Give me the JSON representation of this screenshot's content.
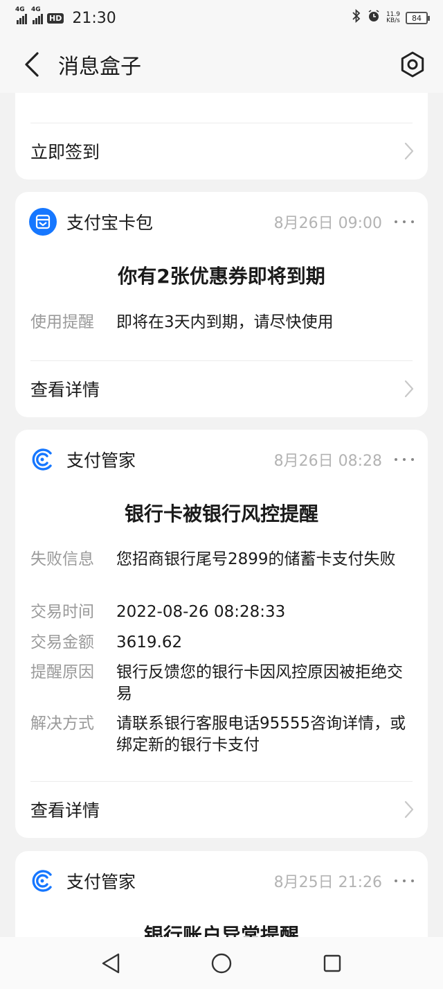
{
  "status_bar": {
    "net1": "4G",
    "net2": "4G",
    "hd": "HD",
    "time": "21:30",
    "speed_value": "11.9",
    "speed_unit": "KB/s",
    "battery": "84"
  },
  "header": {
    "title": "消息盒子"
  },
  "cards": [
    {
      "link_label": "立即签到"
    },
    {
      "app_name": "支付宝卡包",
      "time": "8月26日 09:00",
      "icon": "card-wallet-icon",
      "title": "你有2张优惠券即将到期",
      "rows": [
        {
          "key": "使用提醒",
          "value": "即将在3天内到期，请尽快使用"
        }
      ],
      "link_label": "查看详情"
    },
    {
      "app_name": "支付管家",
      "time": "8月26日 08:28",
      "icon": "payment-butler-icon",
      "title": "银行卡被银行风控提醒",
      "rows": [
        {
          "key": "失败信息",
          "value": "您招商银行尾号2899的储蓄卡支付失败"
        },
        {
          "key": "交易时间",
          "value": "2022-08-26 08:28:33"
        },
        {
          "key": "交易金额",
          "value": "3619.62"
        },
        {
          "key": "提醒原因",
          "value": "银行反馈您的银行卡因风控原因被拒绝交易"
        },
        {
          "key": "解决方式",
          "value": "请联系银行客服电话95555咨询详情，或绑定新的银行卡支付"
        }
      ],
      "link_label": "查看详情"
    },
    {
      "app_name": "支付管家",
      "time": "8月25日 21:26",
      "icon": "payment-butler-icon",
      "title": "银行账户异常提醒"
    }
  ],
  "colors": {
    "accent_blue": "#1677ff",
    "muted_gray": "#9a9a9a"
  }
}
